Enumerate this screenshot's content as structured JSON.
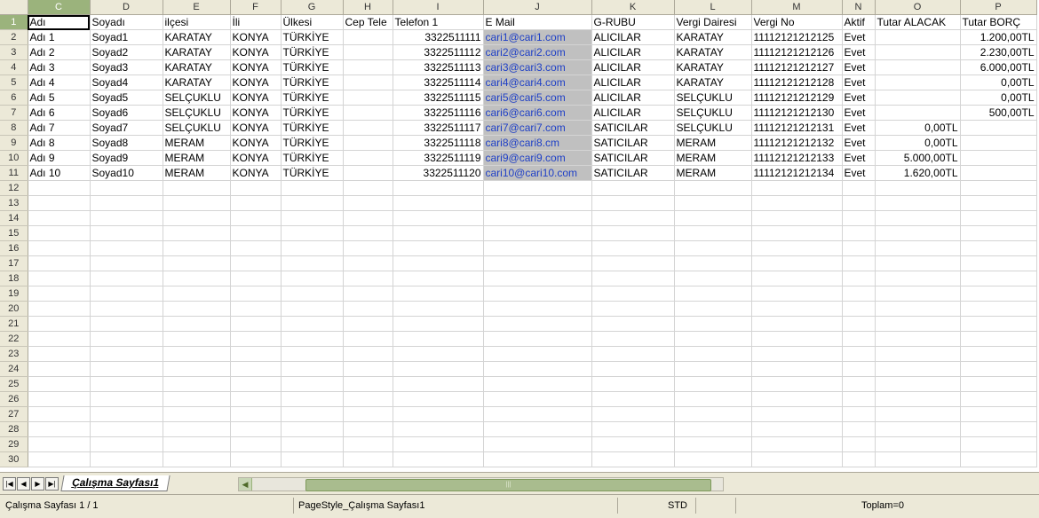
{
  "columns": [
    "C",
    "D",
    "E",
    "F",
    "G",
    "H",
    "I",
    "J",
    "K",
    "L",
    "M",
    "N",
    "O",
    "P"
  ],
  "selected_column": "C",
  "header_row": [
    "Adı",
    "Soyadı",
    "ilçesi",
    "İli",
    "Ülkesi",
    "Cep Tele",
    "Telefon 1",
    "E Mail",
    "G-RUBU",
    "Vergi Dairesi",
    "Vergi No",
    "Aktif",
    "Tutar ALACAK",
    "Tutar BORÇ"
  ],
  "rows": [
    [
      "Adı 1",
      "Soyad1",
      "KARATAY",
      "KONYA",
      "TÜRKİYE",
      "",
      "3322511111",
      "cari1@cari1.com",
      "ALICILAR",
      "KARATAY",
      "11112121212125",
      "Evet",
      "",
      "1.200,00TL"
    ],
    [
      "Adı 2",
      "Soyad2",
      "KARATAY",
      "KONYA",
      "TÜRKİYE",
      "",
      "3322511112",
      "cari2@cari2.com",
      "ALICILAR",
      "KARATAY",
      "11112121212126",
      "Evet",
      "",
      "2.230,00TL"
    ],
    [
      "Adı 3",
      "Soyad3",
      "KARATAY",
      "KONYA",
      "TÜRKİYE",
      "",
      "3322511113",
      "cari3@cari3.com",
      "ALICILAR",
      "KARATAY",
      "11112121212127",
      "Evet",
      "",
      "6.000,00TL"
    ],
    [
      "Adı 4",
      "Soyad4",
      "KARATAY",
      "KONYA",
      "TÜRKİYE",
      "",
      "3322511114",
      "cari4@cari4.com",
      "ALICILAR",
      "KARATAY",
      "11112121212128",
      "Evet",
      "",
      "0,00TL"
    ],
    [
      "Adı 5",
      "Soyad5",
      "SELÇUKLU",
      "KONYA",
      "TÜRKİYE",
      "",
      "3322511115",
      "cari5@cari5.com",
      "ALICILAR",
      "SELÇUKLU",
      "11112121212129",
      "Evet",
      "",
      "0,00TL"
    ],
    [
      "Adı 6",
      "Soyad6",
      "SELÇUKLU",
      "KONYA",
      "TÜRKİYE",
      "",
      "3322511116",
      "cari6@cari6.com",
      "ALICILAR",
      "SELÇUKLU",
      "11112121212130",
      "Evet",
      "",
      "500,00TL"
    ],
    [
      "Adı 7",
      "Soyad7",
      "SELÇUKLU",
      "KONYA",
      "TÜRKİYE",
      "",
      "3322511117",
      "cari7@cari7.com",
      "SATICILAR",
      "SELÇUKLU",
      "11112121212131",
      "Evet",
      "0,00TL",
      ""
    ],
    [
      "Adı 8",
      "Soyad8",
      "MERAM",
      "KONYA",
      "TÜRKİYE",
      "",
      "3322511118",
      "cari8@cari8.cm",
      "SATICILAR",
      "MERAM",
      "11112121212132",
      "Evet",
      "0,00TL",
      ""
    ],
    [
      "Adı 9",
      "Soyad9",
      "MERAM",
      "KONYA",
      "TÜRKİYE",
      "",
      "3322511119",
      "cari9@cari9.com",
      "SATICILAR",
      "MERAM",
      "11112121212133",
      "Evet",
      "5.000,00TL",
      ""
    ],
    [
      "Adı 10",
      "Soyad10",
      "MERAM",
      "KONYA",
      "TÜRKİYE",
      "",
      "3322511120",
      "cari10@cari10.com",
      "SATICILAR",
      "MERAM",
      "11112121212134",
      "Evet",
      "1.620,00TL",
      ""
    ]
  ],
  "total_rows": 30,
  "sheet_tab": "Çalışma Sayfası1",
  "status": {
    "sheet_info": "Çalışma Sayfası 1 / 1",
    "page_style": "PageStyle_Çalışma Sayfası1",
    "mode": "STD",
    "sum": "Toplam=0"
  },
  "icons": {
    "nav_first": "first-sheet-icon",
    "nav_prev": "prev-sheet-icon",
    "nav_next": "next-sheet-icon",
    "nav_last": "last-sheet-icon"
  },
  "colors": {
    "selection_header": "#9bb37c",
    "email_text": "#1e3fc6",
    "email_highlight": "#c0c0c0"
  }
}
